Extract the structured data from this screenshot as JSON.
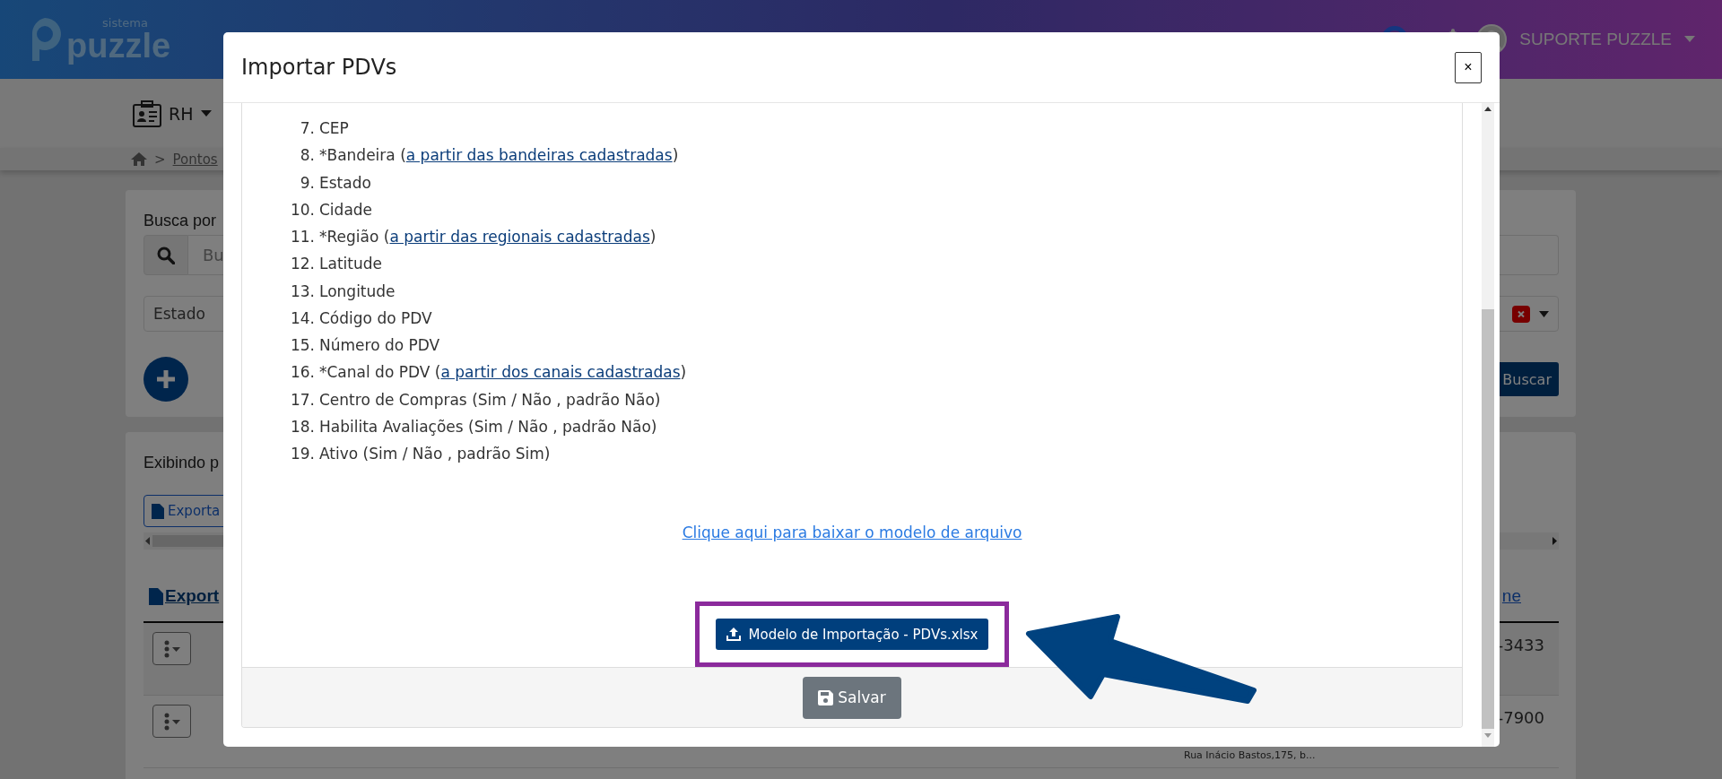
{
  "header": {
    "logo_small": "sistema",
    "logo": "puzzle",
    "user": "SUPORTE PUZZLE"
  },
  "nav": {
    "menu": "RH"
  },
  "breadcrumb": {
    "separator": ">",
    "item": "Pontos"
  },
  "filters": {
    "label": "Busca por",
    "search_placeholder": "Bu",
    "state_select": "Estado",
    "search_button": "Buscar"
  },
  "results": {
    "summary": "Exibindo p",
    "export_button": "Exporta",
    "export_link": "Export",
    "column_link": "ne",
    "rows": [
      {
        "phone": "-3433"
      },
      {
        "phone": "-7900",
        "address": "Rua Inácio Bastos,175, b..."
      }
    ]
  },
  "modal": {
    "title": "Importar PDVs",
    "close": "×",
    "fields": [
      {
        "number": "7.",
        "label": "CEP"
      },
      {
        "number": "8.",
        "label": "*Bandeira (",
        "link": "a partir das bandeiras cadastradas",
        "suffix": ")"
      },
      {
        "number": "9.",
        "label": "Estado"
      },
      {
        "number": "10.",
        "label": "Cidade"
      },
      {
        "number": "11.",
        "label": "*Região (",
        "link": "a partir das regionais cadastradas",
        "suffix": ")"
      },
      {
        "number": "12.",
        "label": "Latitude"
      },
      {
        "number": "13.",
        "label": "Longitude"
      },
      {
        "number": "14.",
        "label": "Código do PDV"
      },
      {
        "number": "15.",
        "label": "Número do PDV"
      },
      {
        "number": "16.",
        "label": "*Canal do PDV (",
        "link": "a partir dos canais cadastradas",
        "suffix": ")"
      },
      {
        "number": "17.",
        "label": "Centro de Compras (Sim / Não , padrão Não)"
      },
      {
        "number": "18.",
        "label": "Habilita Avaliações (Sim / Não , padrão Não)"
      },
      {
        "number": "19.",
        "label": "Ativo (Sim / Não , padrão Sim)"
      }
    ],
    "download_link": "Clique aqui para baixar o modelo de arquivo",
    "file_button": "Modelo de Importação - PDVs.xlsx",
    "save_button": "Salvar"
  }
}
